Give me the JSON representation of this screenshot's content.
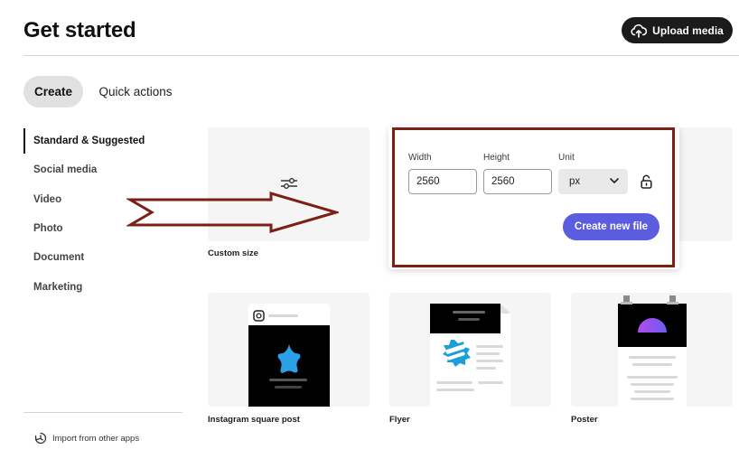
{
  "header": {
    "title": "Get started",
    "upload_label": "Upload media"
  },
  "tabs": [
    {
      "label": "Create",
      "selected": true
    },
    {
      "label": "Quick actions",
      "selected": false
    }
  ],
  "sidebar": {
    "items": [
      {
        "label": "Standard & Suggested",
        "active": true
      },
      {
        "label": "Social media",
        "active": false
      },
      {
        "label": "Video",
        "active": false
      },
      {
        "label": "Photo",
        "active": false
      },
      {
        "label": "Document",
        "active": false
      },
      {
        "label": "Marketing",
        "active": false
      }
    ],
    "import_label": "Import from other apps"
  },
  "cards": {
    "custom": {
      "label": "Custom size",
      "icon": "sliders-icon"
    },
    "instagram": {
      "label": "Instagram square post",
      "icon": "instagram-icon"
    },
    "flyer": {
      "label": "Flyer"
    },
    "poster": {
      "label": "Poster"
    }
  },
  "custom_size_popover": {
    "width_label": "Width",
    "width_value": "2560",
    "height_label": "Height",
    "height_value": "2560",
    "unit_label": "Unit",
    "unit_value": "px",
    "create_label": "Create new file"
  },
  "colors": {
    "accent": "#5c5ce0",
    "annotation": "#7d1f14",
    "dark_button": "#1b1b1b"
  }
}
